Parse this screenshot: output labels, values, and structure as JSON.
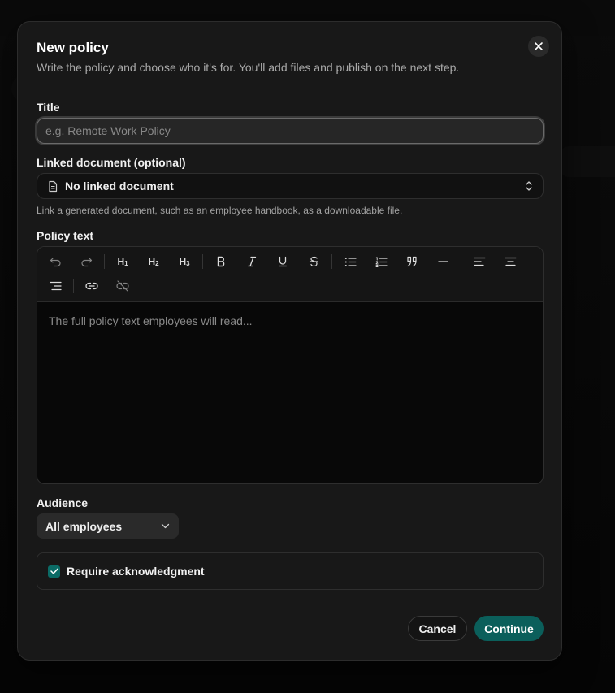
{
  "dialog": {
    "title": "New policy",
    "subtitle": "Write the policy and choose who it's for. You'll add files and publish on the next step."
  },
  "title_field": {
    "label": "Title",
    "placeholder": "e.g. Remote Work Policy",
    "value": ""
  },
  "linked_document": {
    "label": "Linked document (optional)",
    "selected": "No linked document",
    "hint": "Link a generated document, such as an employee handbook, as a downloadable file."
  },
  "policy_text": {
    "label": "Policy text",
    "placeholder": "The full policy text employees will read...",
    "toolbar": {
      "h1": "H1",
      "h2": "H2",
      "h3": "H3"
    }
  },
  "audience": {
    "label": "Audience",
    "selected": "All employees"
  },
  "acknowledgment": {
    "label": "Require acknowledgment",
    "checked": true
  },
  "actions": {
    "cancel": "Cancel",
    "continue": "Continue"
  },
  "colors": {
    "accent": "#0b5f5b",
    "dialog_bg": "#181818",
    "page_bg": "#000000"
  },
  "icons": [
    "close-icon",
    "document-icon",
    "chevron-up-down-icon",
    "undo-icon",
    "redo-icon",
    "bold-icon",
    "italic-icon",
    "underline-icon",
    "strikethrough-icon",
    "bullet-list-icon",
    "ordered-list-icon",
    "quote-icon",
    "horizontal-rule-icon",
    "align-left-icon",
    "align-center-icon",
    "align-right-icon",
    "link-icon",
    "unlink-icon",
    "chevron-down-icon",
    "check-icon"
  ]
}
